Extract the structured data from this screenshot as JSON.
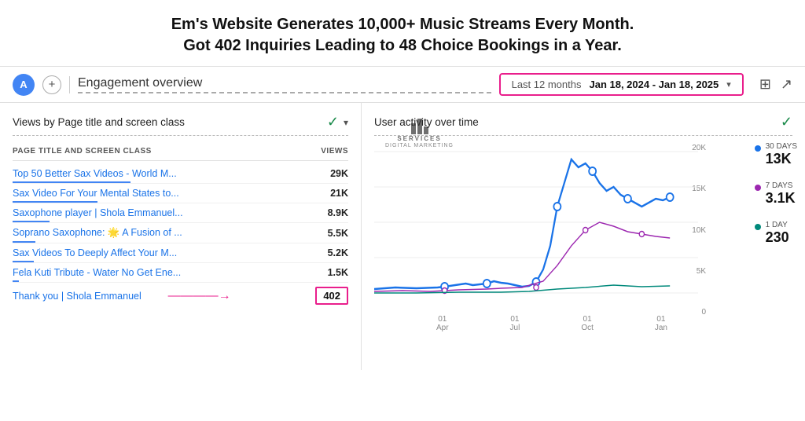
{
  "headline": {
    "line1": "Em's Website Generates 10,000+ Music Streams Every Month.",
    "line2": "Got 402 Inquiries Leading to 48 Choice Bookings in a Year."
  },
  "navbar": {
    "avatar_label": "A",
    "plus_label": "+",
    "title": "Engagement overview",
    "date_range_label": "Last 12 months",
    "date_range_value": "Jan 18, 2024 - Jan 18, 2025"
  },
  "left_panel": {
    "title": "Views by Page title and screen class",
    "col_page": "PAGE TITLE AND SCREEN CLASS",
    "col_views": "VIEWS",
    "rows": [
      {
        "title": "Top 50 Better Sax Videos - World M...",
        "views": "29K",
        "bar_pct": 100
      },
      {
        "title": "Sax Video For Your Mental States to...",
        "views": "21K",
        "bar_pct": 72
      },
      {
        "title": "Saxophone player | Shola Emmanuel...",
        "views": "8.9K",
        "bar_pct": 31
      },
      {
        "title": "Soprano Saxophone: 🌟 A Fusion of ...",
        "views": "5.5K",
        "bar_pct": 19
      },
      {
        "title": "Sax Videos To Deeply Affect Your M...",
        "views": "5.2K",
        "bar_pct": 18
      },
      {
        "title": "Fela Kuti Tribute - Water No Get Ene...",
        "views": "1.5K",
        "bar_pct": 5
      }
    ],
    "thank_you_row": {
      "title": "Thank you | Shola Emmanuel",
      "value": "402"
    }
  },
  "right_panel": {
    "title": "User activity over time",
    "stats": [
      {
        "label": "30 DAYS",
        "value": "13K",
        "color_class": "stat-dot-blue"
      },
      {
        "label": "7 DAYS",
        "value": "3.1K",
        "color_class": "stat-dot-purple"
      },
      {
        "label": "1 DAY",
        "value": "230",
        "color_class": "stat-dot-teal"
      }
    ],
    "y_axis": [
      "20K",
      "15K",
      "10K",
      "5K",
      "0"
    ],
    "x_axis": [
      "01\nApr",
      "01\nJul",
      "01\nOct",
      "01\nJan"
    ],
    "logo": {
      "text1": "SERVICES",
      "text2": "DIGITAL MARKETING"
    }
  }
}
